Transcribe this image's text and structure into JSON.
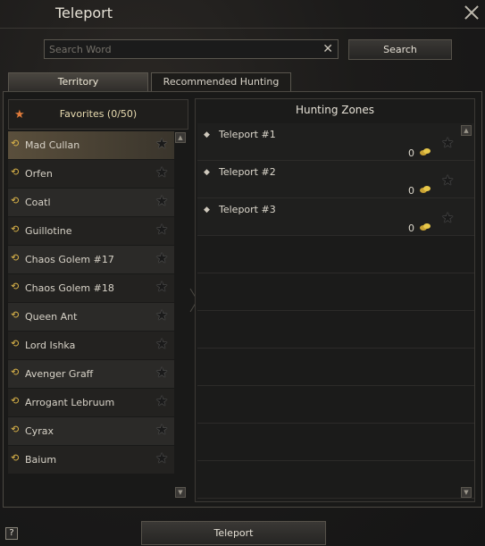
{
  "window": {
    "title": "Teleport"
  },
  "search": {
    "placeholder": "Search Word",
    "value": "",
    "clear_symbol": "✕",
    "button_label": "Search"
  },
  "tabs": [
    {
      "label": "Territory",
      "active": true
    },
    {
      "label": "Recommended Hunting Zone",
      "active": false
    }
  ],
  "favorites": {
    "label": "Favorites (0/50)"
  },
  "territories": [
    {
      "label": "Mad Cullan",
      "selected": true
    },
    {
      "label": "Orfen"
    },
    {
      "label": "Coatl"
    },
    {
      "label": "Guillotine"
    },
    {
      "label": "Chaos Golem #17"
    },
    {
      "label": "Chaos Golem #18"
    },
    {
      "label": "Queen Ant"
    },
    {
      "label": "Lord Ishka"
    },
    {
      "label": "Avenger Graff"
    },
    {
      "label": "Arrogant Lebruum"
    },
    {
      "label": "Cyrax"
    },
    {
      "label": "Baium"
    }
  ],
  "hunting_zones": {
    "title": "Hunting Zones",
    "items": [
      {
        "name": "Teleport #1",
        "cost": "0"
      },
      {
        "name": "Teleport #2",
        "cost": "0"
      },
      {
        "name": "Teleport #3",
        "cost": "0"
      }
    ]
  },
  "footer": {
    "teleport_label": "Teleport",
    "help_label": "?"
  },
  "colors": {
    "favorite_star": "#e07b3a",
    "territory_icon": "#e0b84a",
    "coin": "#e8c84a"
  }
}
